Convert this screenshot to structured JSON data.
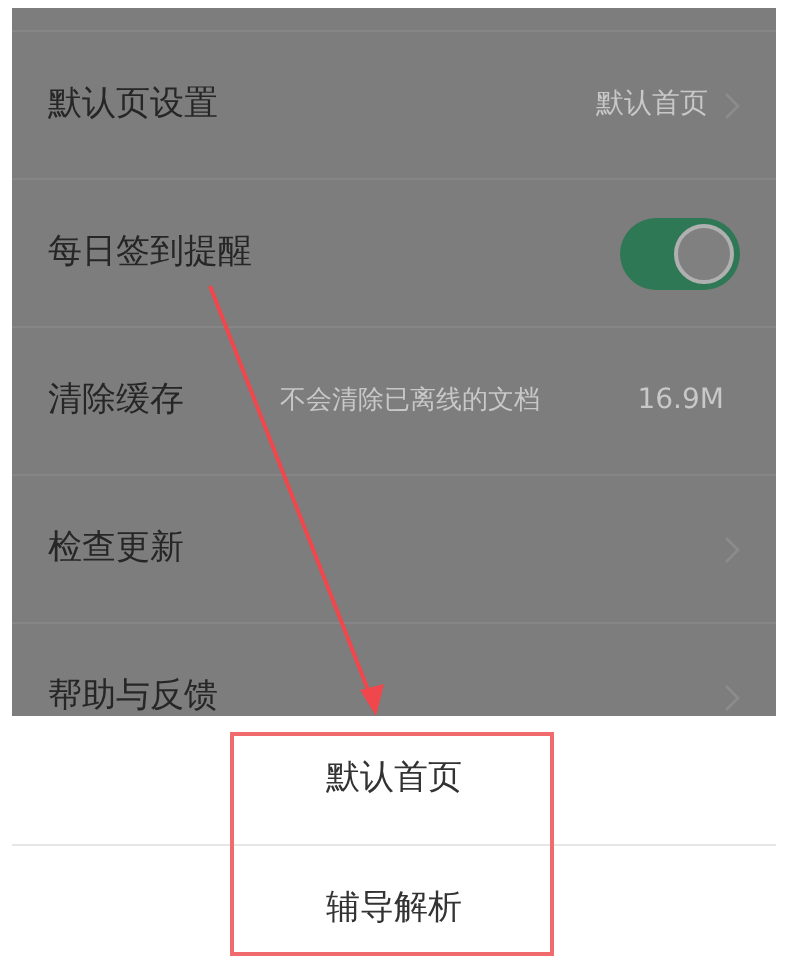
{
  "settings": [
    {
      "kind": "link",
      "label": "默认页设置",
      "value": "默认首页"
    },
    {
      "kind": "toggle",
      "label": "每日签到提醒",
      "on": true
    },
    {
      "kind": "info",
      "label": "清除缓存",
      "note": "不会清除已离线的文档",
      "size": "16.9M"
    },
    {
      "kind": "link",
      "label": "检查更新"
    },
    {
      "kind": "link",
      "label": "帮助与反馈"
    }
  ],
  "sheet": {
    "options": [
      "默认首页",
      "辅导解析"
    ]
  }
}
